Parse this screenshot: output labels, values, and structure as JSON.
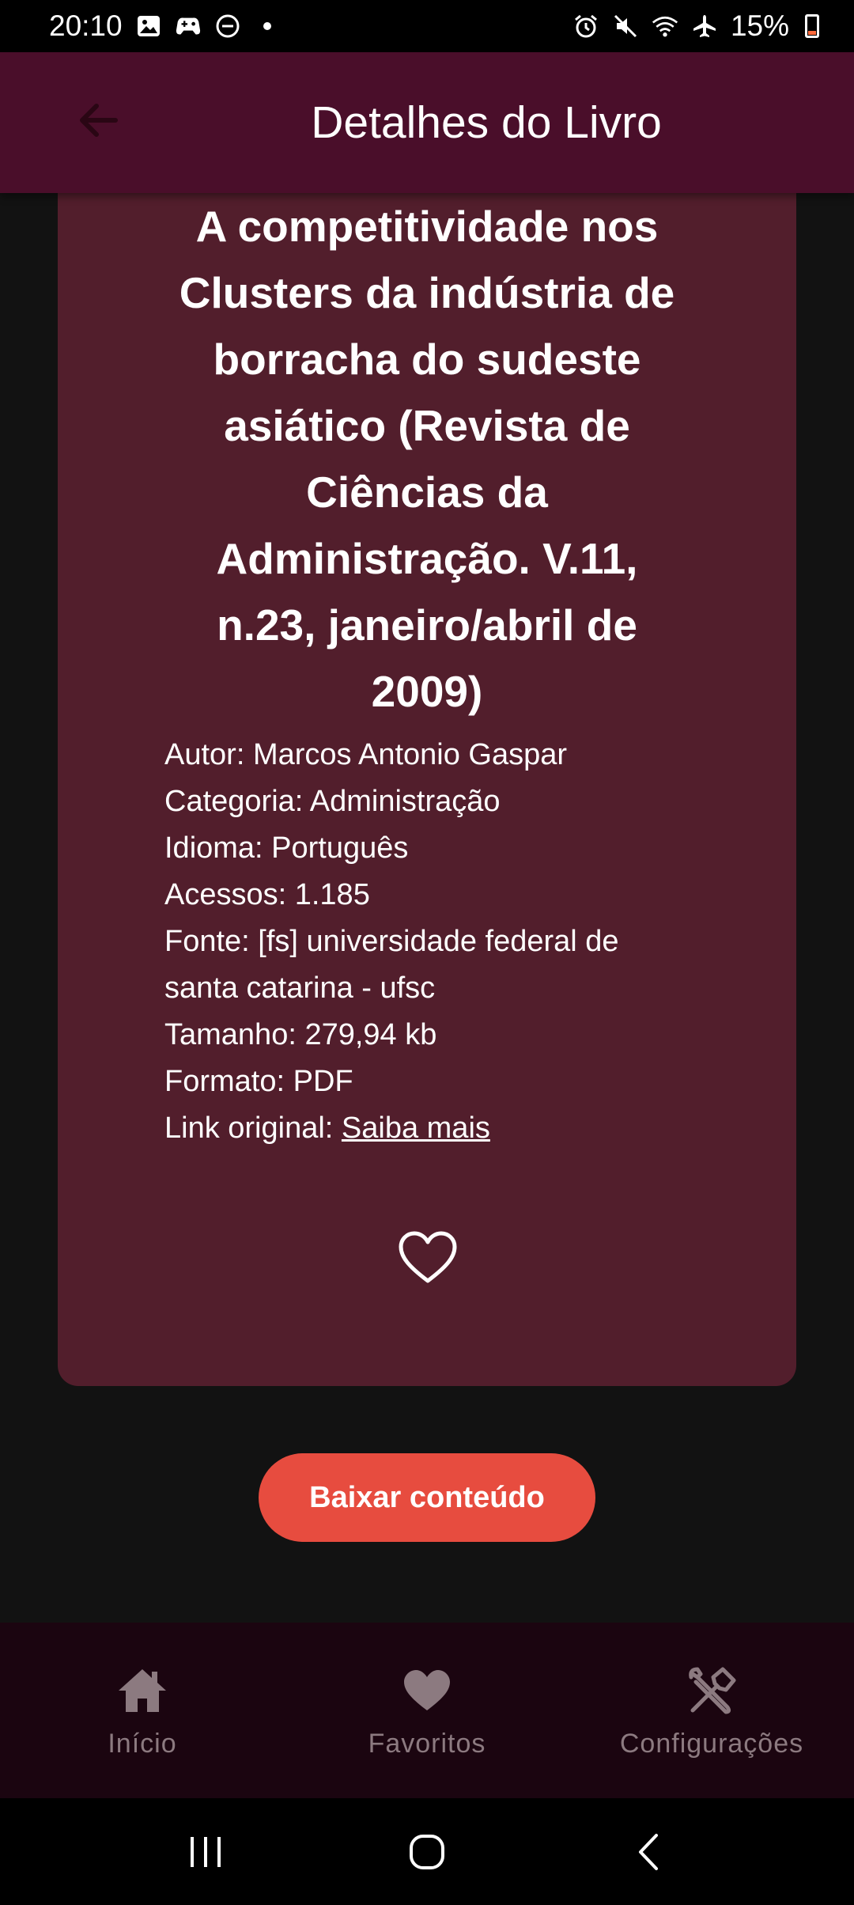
{
  "status_bar": {
    "time": "20:10",
    "battery_percent": "15%",
    "left_icons": [
      "gallery-icon",
      "game-controller-icon",
      "do-not-disturb-icon",
      "dot-icon"
    ],
    "right_icons": [
      "alarm-icon",
      "mute-icon",
      "wifi-icon",
      "airplane-icon",
      "battery-icon"
    ],
    "battery_fill_color": "#ff6b3d"
  },
  "app_bar": {
    "title": "Detalhes do Livro",
    "background": "#4a0e2a"
  },
  "book": {
    "title": "A competitividade nos Clusters da indústria de borracha do sudeste asiático (Revista de Ciências da Administração. V.11, n.23, janeiro/abril de 2009)",
    "title_lines": [
      "A competitividade nos",
      "Clusters da indústria de",
      "borracha do sudeste",
      "asiático (Revista de",
      "Ciências da",
      "Administração. V.11,",
      "n.23, janeiro/abril de",
      "2009)"
    ],
    "author": "Autor: Marcos Antonio Gaspar",
    "category": "Categoria: Administração",
    "language": "Idioma: Português",
    "accesses": "Acessos: 1.185",
    "source_line1": "Fonte: [fs] universidade federal de",
    "source_line2": "santa catarina - ufsc",
    "size": "Tamanho: 279,94 kb",
    "format": "Formato: PDF",
    "link_label": "Link original: ",
    "link_text": "Saiba mais",
    "card_color": "#521e2c"
  },
  "actions": {
    "download_label": "Baixar conteúdo",
    "download_color": "#e74c3f",
    "favorite_icon": "heart-outline-icon"
  },
  "bottom_nav": {
    "items": [
      {
        "label": "Início",
        "icon": "home-icon"
      },
      {
        "label": "Favoritos",
        "icon": "heart-icon"
      },
      {
        "label": "Configurações",
        "icon": "tools-icon"
      }
    ],
    "background": "#1b0510"
  },
  "system_nav": {
    "buttons": [
      "recent-apps-icon",
      "home-circle-icon",
      "back-chevron-icon"
    ]
  }
}
